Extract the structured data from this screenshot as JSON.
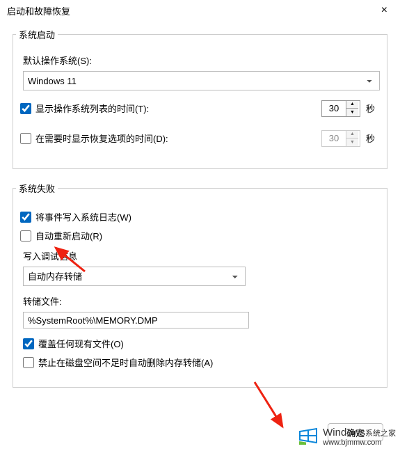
{
  "titlebar": {
    "title": "启动和故障恢复",
    "close": "×"
  },
  "startup": {
    "legend": "系统启动",
    "default_os_label": "默认操作系统(S):",
    "default_os_value": "Windows 11",
    "show_os_list": {
      "label": "显示操作系统列表的时间(T):",
      "checked": true,
      "value": "30",
      "unit": "秒"
    },
    "show_recovery": {
      "label": "在需要时显示恢复选项的时间(D):",
      "checked": false,
      "value": "30",
      "unit": "秒"
    }
  },
  "failure": {
    "legend": "系统失败",
    "write_event_log": {
      "label": "将事件写入系统日志(W)",
      "checked": true
    },
    "auto_restart": {
      "label": "自动重新启动(R)",
      "checked": false
    },
    "debug": {
      "label": "写入调试信息",
      "value": "自动内存转储",
      "dump_file_label": "转储文件:",
      "dump_file_value": "%SystemRoot%\\MEMORY.DMP",
      "overwrite": {
        "label": "覆盖任何现有文件(O)",
        "checked": true
      },
      "disable_auto_delete": {
        "label": "禁止在磁盘空间不足时自动删除内存转储(A)",
        "checked": false
      }
    }
  },
  "buttons": {
    "ok": "确定"
  },
  "watermark": {
    "brand": "Windows",
    "site": "系统之家",
    "url": "www.bjmmw.com"
  }
}
